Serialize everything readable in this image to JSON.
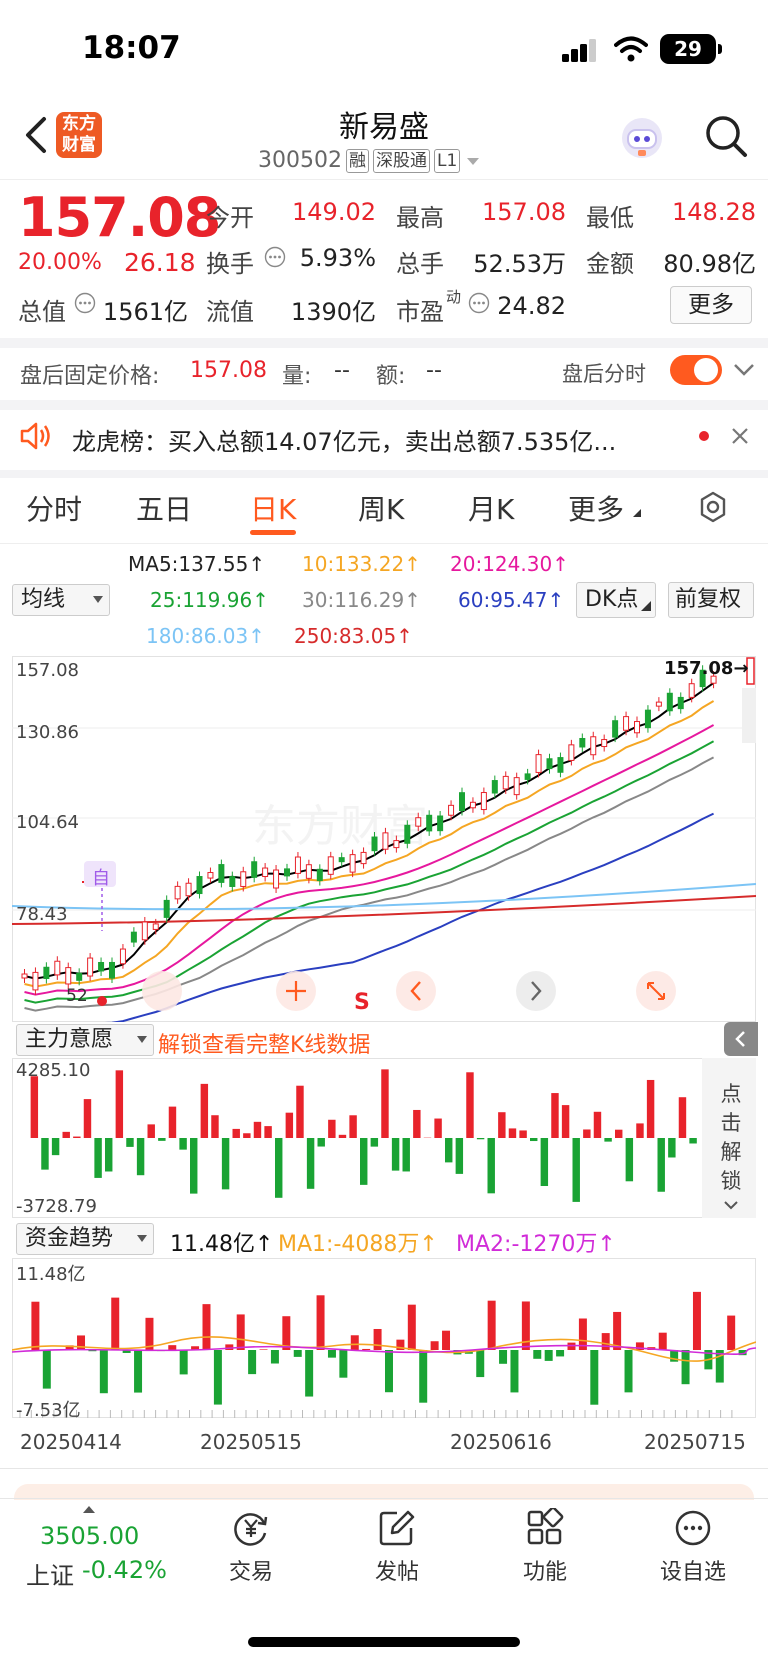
{
  "status": {
    "time": "18:07",
    "battery": "29"
  },
  "header": {
    "logo_text": "东方\n财富",
    "name": "新易盛",
    "code": "300502",
    "tags": [
      "融",
      "深股通",
      "L1"
    ]
  },
  "quote": {
    "price": "157.08",
    "pct": "20.00%",
    "change": "26.18",
    "fields": {
      "open_label": "今开",
      "open": "149.02",
      "high_label": "最高",
      "high": "157.08",
      "low_label": "最低",
      "low": "148.28",
      "turnover_label": "换手",
      "turnover": "5.93%",
      "volume_label": "总手",
      "volume": "52.53万",
      "amount_label": "金额",
      "amount": "80.98亿",
      "mktcap_label": "总值",
      "mktcap": "1561亿",
      "float_label": "流值",
      "float": "1390亿",
      "pe_label": "市盈",
      "pe_sup": "动",
      "pe": "24.82"
    },
    "more_label": "更多"
  },
  "after_hours": {
    "label": "盘后固定价格:",
    "price": "157.08",
    "vol_label": "量:",
    "vol": "--",
    "amt_label": "额:",
    "amt": "--",
    "timeshare_label": "盘后分时"
  },
  "lhb": {
    "text": "龙虎榜：买入总额14.07亿元，卖出总额7.535亿..."
  },
  "tabs": [
    "分时",
    "五日",
    "日K",
    "周K",
    "月K",
    "更多"
  ],
  "active_tab": "日K",
  "ma": {
    "ma5": "MA5:137.55↑",
    "ma10": "10:133.22↑",
    "ma20": "20:124.30↑",
    "ma25": "25:119.96↑",
    "ma30": "30:116.29↑",
    "ma60": "60:95.47↑",
    "ma180": "180:86.03↑",
    "ma250": "250:83.05↑",
    "select_label": "均线",
    "dk_label": "DK点",
    "fq_label": "前复权",
    "colors": {
      "ma5": "#000000",
      "ma10": "#f5a623",
      "ma20": "#e6189e",
      "ma25": "#1aa334",
      "ma30": "#888888",
      "ma60": "#2a3fc0",
      "ma180": "#7cc4f5",
      "ma250": "#d62b2b"
    }
  },
  "kline": {
    "y_labels": [
      "157.08",
      "130.86",
      "104.64",
      "78.43"
    ],
    "last_label": "157.08→",
    "marker_zi": "自",
    "low_label": "52",
    "s_marker": "S"
  },
  "indicator1": {
    "select_label": "主力意愿",
    "unlock_text": "解锁查看完整K线数据",
    "top": "4285.10",
    "bottom": "-3728.79",
    "side_text": "点击解锁"
  },
  "indicator2": {
    "select_label": "资金趋势",
    "value": "11.48亿↑",
    "ma1": "MA1:-4088万↑",
    "ma2": "MA2:-1270万↑",
    "top": "11.48亿",
    "bottom": "-7.53亿"
  },
  "dates": [
    "20250414",
    "20250515",
    "20250616",
    "20250715"
  ],
  "bottom_bar": {
    "index_value": "3505.00",
    "index_name": "上证",
    "index_pct": "-0.42%",
    "items": [
      "交易",
      "发帖",
      "功能",
      "设自选"
    ]
  }
}
